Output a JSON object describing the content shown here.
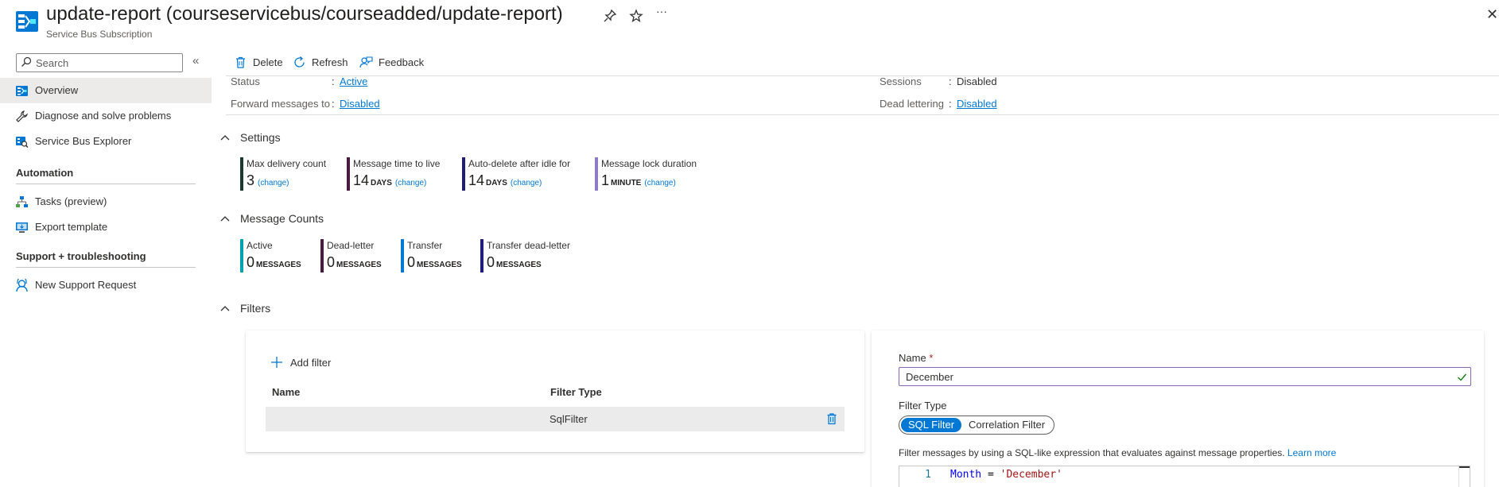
{
  "header": {
    "title": "update-report (courseservicebus/courseadded/update-report)",
    "subtitle": "Service Bus Subscription",
    "pin_icon": "pin-icon",
    "favorite_icon": "star-icon",
    "more_label": "···",
    "close_label": "✕"
  },
  "sidebar": {
    "search_placeholder": "Search",
    "collapse_label": "«",
    "items": [
      {
        "label": "Overview",
        "icon": "overview-icon",
        "active": true
      },
      {
        "label": "Diagnose and solve problems",
        "icon": "wrench-icon"
      },
      {
        "label": "Service Bus Explorer",
        "icon": "explorer-icon"
      }
    ],
    "sections": [
      {
        "title": "Automation",
        "items": [
          {
            "label": "Tasks (preview)",
            "icon": "tasks-icon"
          },
          {
            "label": "Export template",
            "icon": "export-template-icon"
          }
        ]
      },
      {
        "title": "Support + troubleshooting",
        "items": [
          {
            "label": "New Support Request",
            "icon": "support-request-icon"
          }
        ]
      }
    ]
  },
  "toolbar": {
    "delete_label": "Delete",
    "refresh_label": "Refresh",
    "feedback_label": "Feedback"
  },
  "essentials": {
    "colon": ":",
    "status_key": "Status",
    "status_value": "Active",
    "forward_key": "Forward messages to",
    "forward_value": "Disabled",
    "sessions_key": "Sessions",
    "sessions_value": "Disabled",
    "dead_key": "Dead lettering",
    "dead_value": "Disabled"
  },
  "settings": {
    "title": "Settings",
    "tiles": [
      {
        "label": "Max delivery count",
        "value": "3",
        "unit": "",
        "change": "(change)",
        "color": "#1b3a2f"
      },
      {
        "label": "Message time to live",
        "value": "14",
        "unit": "DAYS",
        "change": "(change)",
        "color": "#4a1942"
      },
      {
        "label": "Auto-delete after idle for",
        "value": "14",
        "unit": "DAYS",
        "change": "(change)",
        "color": "#1f1c7a"
      },
      {
        "label": "Message lock duration",
        "value": "1",
        "unit": "MINUTE",
        "change": "(change)",
        "color": "#8f7cc9"
      }
    ]
  },
  "message_counts": {
    "title": "Message Counts",
    "tiles": [
      {
        "label": "Active",
        "value": "0",
        "unit": "MESSAGES",
        "color": "#00a2ad"
      },
      {
        "label": "Dead-letter",
        "value": "0",
        "unit": "MESSAGES",
        "color": "#4a1942"
      },
      {
        "label": "Transfer",
        "value": "0",
        "unit": "MESSAGES",
        "color": "#0078d4"
      },
      {
        "label": "Transfer dead-letter",
        "value": "0",
        "unit": "MESSAGES",
        "color": "#1f1c7a"
      }
    ]
  },
  "filters": {
    "title": "Filters",
    "add_label": "Add filter",
    "columns": [
      "Name",
      "Filter Type"
    ],
    "rows": [
      {
        "name": "",
        "type": "SqlFilter"
      }
    ]
  },
  "filter_editor": {
    "name_label": "Name",
    "required_mark": "*",
    "name_value": "December",
    "type_label": "Filter Type",
    "type_options": [
      "SQL Filter",
      "Correlation Filter"
    ],
    "selected_type": "SQL Filter",
    "help_text": "Filter messages by using a SQL-like expression that evaluates against message properties.",
    "learn_more": "Learn more",
    "line_number": "1",
    "code_keyword": "Month",
    "code_operator": " = ",
    "code_string": "'December'"
  },
  "colors": {
    "accent": "#0078d4",
    "active_nav_bg": "#edebe9",
    "name_field_border": "#8764b8",
    "check_green": "#107c10"
  }
}
